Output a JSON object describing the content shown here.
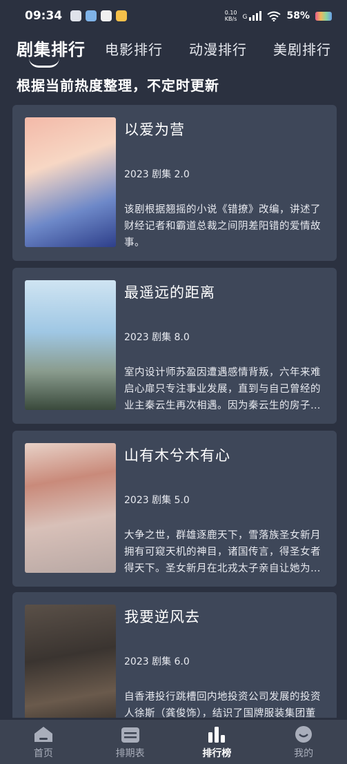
{
  "status": {
    "time": "09:34",
    "speed_value": "0.10",
    "speed_unit": "KB/s",
    "network": "G",
    "battery": "58%"
  },
  "tabs": [
    {
      "label": "剧集排行",
      "active": true
    },
    {
      "label": "电影排行",
      "active": false
    },
    {
      "label": "动漫排行",
      "active": false
    },
    {
      "label": "美剧排行",
      "active": false
    }
  ],
  "subtitle": "根据当前热度整理，不定时更新",
  "items": [
    {
      "title": "以爱为营",
      "meta": "2023 剧集 2.0",
      "desc": "该剧根据翘摇的小说《错撩》改编，讲述了财经记者和霸道总裁之间阴差阳错的爱情故事。"
    },
    {
      "title": "最遥远的距离",
      "meta": "2023 剧集 8.0",
      "desc": "室内设计师苏盈因遭遇感情背叛，六年来难启心扉只专注事业发展，直到与自己曾经的业主秦云生再次相遇。因为秦云生的房子需要重新翻修，两人一起…"
    },
    {
      "title": "山有木兮木有心",
      "meta": "2023 剧集 5.0",
      "desc": "大争之世，群雄逐鹿天下，雪落族圣女新月拥有可窥天机的神目，诸国传言，得圣女者得天下。圣女新月在北戎太子亲自让她为北戎窥得天机时，趁大火…"
    },
    {
      "title": "我要逆风去",
      "meta": "2023 剧集 6.0",
      "desc": "自香港投行跳槽回内地投资公司发展的投资人徐斯（龚俊饰），结识了国牌服装集团董事长独生女江湖（钟楚曦"
    }
  ],
  "nav": [
    {
      "label": "首页",
      "icon": "home-icon",
      "active": false
    },
    {
      "label": "排期表",
      "icon": "calendar-icon",
      "active": false
    },
    {
      "label": "排行榜",
      "icon": "bar-chart-icon",
      "active": true
    },
    {
      "label": "我的",
      "icon": "smiley-icon",
      "active": false
    }
  ],
  "colors": {
    "background": "#2b3140",
    "card": "#3e4759",
    "nav": "#3c4352"
  }
}
